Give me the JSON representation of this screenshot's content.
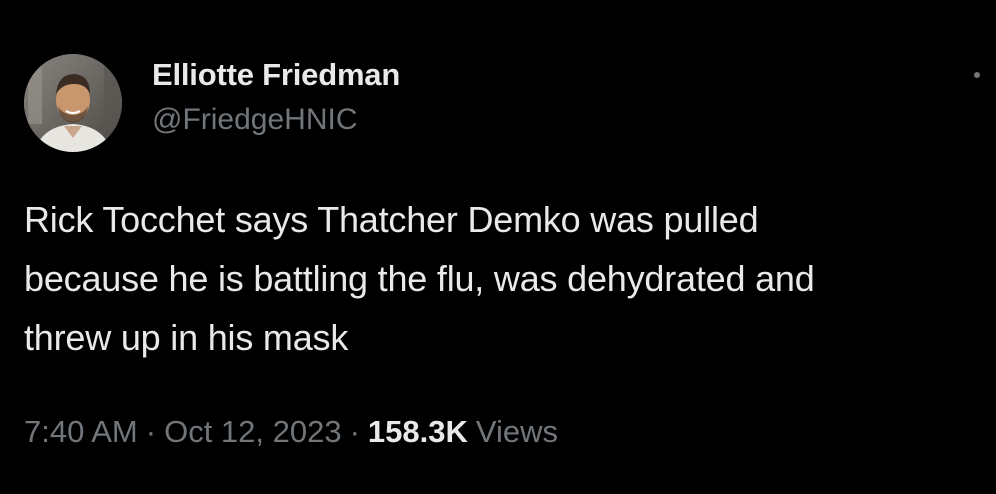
{
  "author": {
    "display_name": "Elliotte Friedman",
    "handle": "@FriedgeHNIC",
    "avatar_icon": "profile-photo"
  },
  "tweet": {
    "text": "Rick Tocchet says Thatcher Demko was pulled\nbecause he is battling the flu, was dehydrated and\nthrew up in his mask",
    "time": "7:40 AM",
    "separator": "·",
    "date": "Oct 12, 2023",
    "views_count": "158.3K",
    "views_label": "Views"
  },
  "menu": {
    "icon": "more-options-icon"
  },
  "colors": {
    "background": "#000000",
    "primary_text": "#e7e9ea",
    "secondary_text": "#71767b"
  }
}
